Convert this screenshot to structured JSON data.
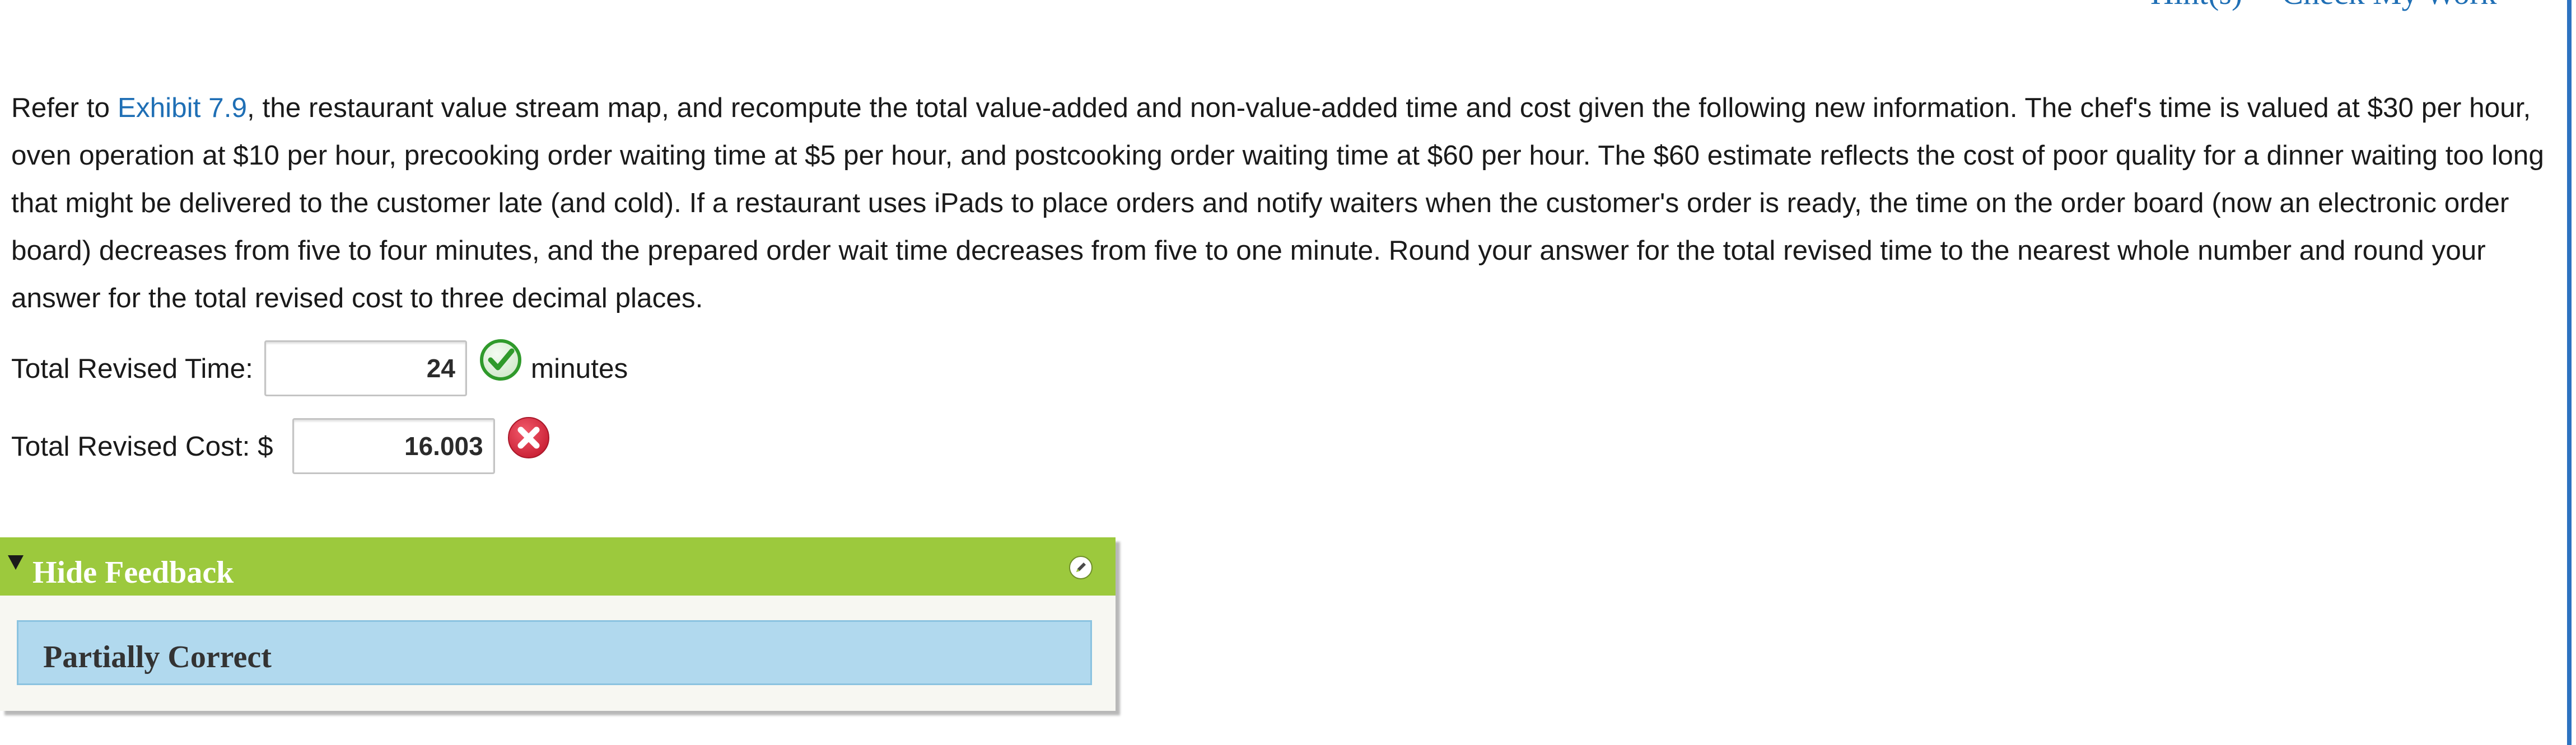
{
  "header": {
    "hint_label": "Hint(s)",
    "check_label": "Check My Work"
  },
  "question": {
    "intro": "Refer to ",
    "exhibit_link": "Exhibit 7.9",
    "body": ", the restaurant value stream map, and recompute the total value-added and non-value-added time and cost given the following new information. The chef's time is valued at $30 per hour, oven operation at $10 per hour, precooking order waiting time at $5 per hour, and postcooking order waiting time at $60 per hour. The $60 estimate reflects the cost of poor quality for a dinner waiting too long that might be delivered to the customer late (and cold). If a restaurant uses iPads to place orders and notify waiters when the customer's order is ready, the time on the order board (now an electronic order board) decreases from five to four minutes, and the prepared order wait time decreases from five to one minute. Round your answer for the total revised time to the nearest whole number and round your answer for the total revised cost to three decimal places."
  },
  "answers": {
    "time": {
      "label": "Total Revised Time:",
      "value": "24",
      "unit": "minutes",
      "status": "correct",
      "status_icon": "check-circle-icon",
      "status_color": "#2f9a2b"
    },
    "cost": {
      "label": "Total Revised Cost: $",
      "value": "16.003",
      "status": "incorrect",
      "status_icon": "x-circle-icon",
      "status_color": "#d7263d"
    }
  },
  "feedback": {
    "toggle_label": "Hide Feedback",
    "status_text": "Partially Correct",
    "header_color": "#9cc93d",
    "body_color": "#b1d9ee"
  }
}
